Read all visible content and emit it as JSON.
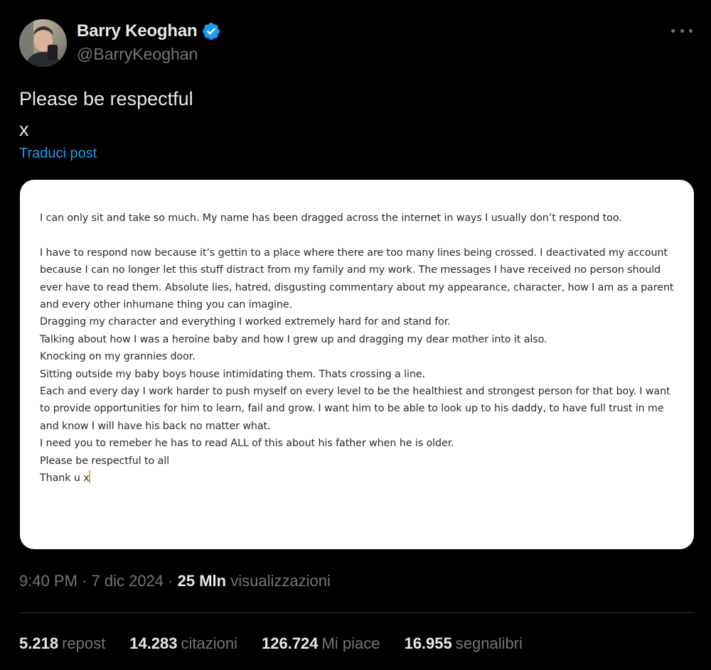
{
  "author": {
    "display_name": "Barry Keoghan",
    "handle": "@BarryKeoghan",
    "verified": true,
    "avatar_icon": "avatar-photo-icon",
    "verified_color": "#1d9bf0"
  },
  "tweet": {
    "text_line_1": "Please be respectful",
    "text_line_2": "x",
    "translate_label": "Traduci post"
  },
  "statement": {
    "lines": [
      "I can only sit and take so much. My name has been dragged across the internet in ways I usually don’t respond too.",
      "",
      "I have to respond now because it’s gettin to a place where there are too many lines being crossed. I deactivated my account",
      "because I can no longer let this stuff distract from my family and my work. The messages I have received no person should",
      "ever have to read them. Absolute lies, hatred, disgusting commentary about my appearance, character, how I am as a parent",
      "and every other inhumane thing you can imagine.",
      "Dragging my character and everything I worked extremely hard for and stand for.",
      "Talking about how I was a heroine baby and how I grew up and dragging my dear mother into it also.",
      "Knocking on my grannies door.",
      "Sitting outside my baby boys house intimidating them. Thats crossing a line.",
      "Each and every day I work harder to push myself on every level to be the healthiest and strongest person for that boy. I want",
      "to provide opportunities for him to learn, fail and grow. I want him to be able to look up to his daddy, to have full trust in me",
      "and know I will have his back no matter what.",
      "I need you to remeber he has to read ALL of this about his father when he is older.",
      "Please be respectful to all",
      "Thank u x"
    ]
  },
  "meta": {
    "time": "9:40 PM",
    "separator_1": "·",
    "date": "7 dic 2024",
    "separator_2": "·",
    "views_count": "25 Mln",
    "views_label": "visualizzazioni"
  },
  "stats": {
    "reposts_count": "5.218",
    "reposts_label": "repost",
    "quotes_count": "14.283",
    "quotes_label": "citazioni",
    "likes_count": "126.724",
    "likes_label": "Mi piace",
    "bookmarks_count": "16.955",
    "bookmarks_label": "segnalibri"
  },
  "colors": {
    "background": "#000000",
    "text_primary": "#e7e9ea",
    "text_secondary": "#71767b",
    "link": "#1d9bf0",
    "divider": "#2f3336"
  }
}
